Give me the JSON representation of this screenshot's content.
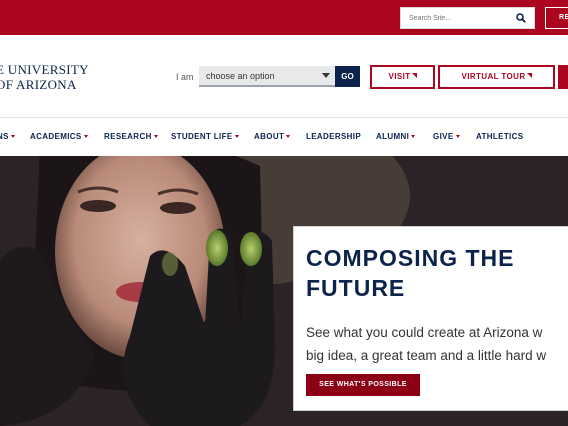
{
  "colors": {
    "brand_red": "#ab0520",
    "brand_blue": "#0c234b"
  },
  "topbar": {
    "search_placeholder": "Search Site...",
    "search_icon": "search-icon",
    "right_button_label": "RE"
  },
  "header": {
    "logo_line1": "E UNIVERSITY",
    "logo_line2": "OF ARIZONA",
    "iam_label": "I am",
    "select_value": "choose an option",
    "go_label": "GO",
    "visit_label": "VISIT",
    "tour_label": "VIRTUAL TOUR"
  },
  "nav": {
    "items": [
      {
        "label": "NS",
        "dropdown": true
      },
      {
        "label": "ACADEMICS",
        "dropdown": true
      },
      {
        "label": "RESEARCH",
        "dropdown": true
      },
      {
        "label": "STUDENT LIFE",
        "dropdown": true
      },
      {
        "label": "ABOUT",
        "dropdown": true
      },
      {
        "label": "LEADERSHIP",
        "dropdown": false
      },
      {
        "label": "ALUMNI",
        "dropdown": true
      },
      {
        "label": "GIVE",
        "dropdown": true
      },
      {
        "label": "ATHLETICS",
        "dropdown": false
      }
    ]
  },
  "hero": {
    "title_line1": "COMPOSING THE",
    "title_line2": "FUTURE",
    "body_line1": "See what you could create at Arizona w",
    "body_line2": "big idea, a great team and a little hard w",
    "cta_label": "SEE WHAT'S POSSIBLE"
  }
}
